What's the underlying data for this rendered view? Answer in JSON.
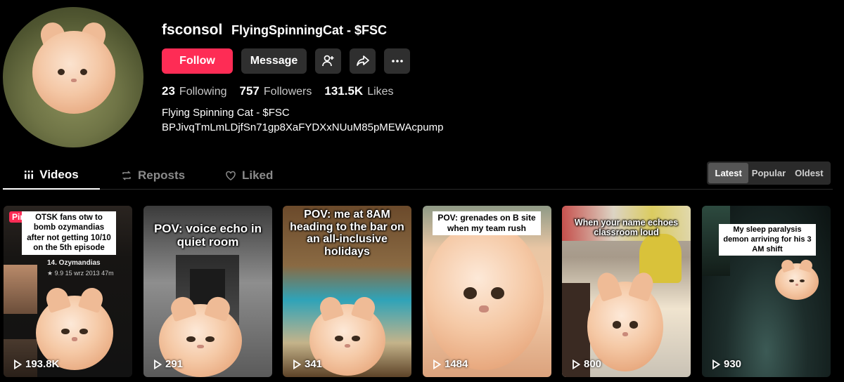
{
  "profile": {
    "username": "fsconsol",
    "nickname": "FlyingSpinningCat - $FSC",
    "follow_label": "Follow",
    "message_label": "Message",
    "stats": [
      {
        "value": "23",
        "label": "Following"
      },
      {
        "value": "757",
        "label": "Followers"
      },
      {
        "value": "131.5K",
        "label": "Likes"
      }
    ],
    "bio_line1": "Flying Spinning Cat - $FSC",
    "bio_line2": "BPJivqTmLmLDjfSn71gp8XaFYDXxNUuM85pMEWAcpump"
  },
  "tabs": {
    "videos": "Videos",
    "reposts": "Reposts",
    "liked": "Liked"
  },
  "sort": {
    "latest": "Latest",
    "popular": "Popular",
    "oldest": "Oldest",
    "active": "Latest"
  },
  "videos": [
    {
      "pinned_label": "Pinned",
      "caption": "OTSK fans otw to bomb ozymandias after not getting 10/10 on the 5th episode",
      "episode_title": "14. Ozymandias",
      "episode_meta": "★ 9.9  15 wrz 2013  47m",
      "views": "193.8K"
    },
    {
      "caption": "POV: voice echo in quiet room",
      "views": "291"
    },
    {
      "caption": "POV: me at 8AM heading to the bar on an all-inclusive holidays",
      "views": "341"
    },
    {
      "caption": "POV: grenades on B site when my team rush",
      "views": "1484"
    },
    {
      "caption": "When your name echoes classroom loud",
      "views": "800"
    },
    {
      "caption": "My sleep paralysis demon arriving for his 3 AM shift",
      "views": "930"
    }
  ],
  "colors": {
    "accent": "#fe2c55",
    "button_dark": "#2f2f2f",
    "background": "#000000"
  }
}
